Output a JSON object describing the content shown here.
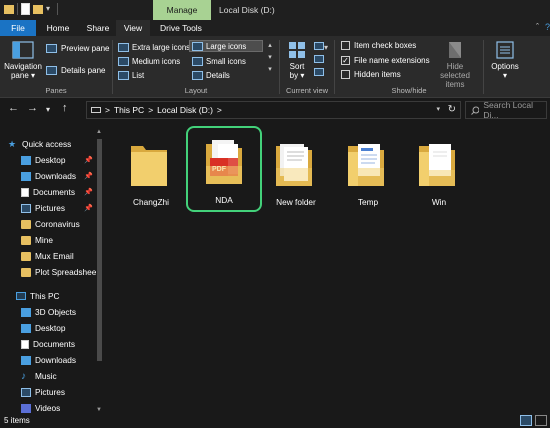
{
  "window": {
    "title": "Local Disk (D:)",
    "manage_label": "Manage"
  },
  "tabs": [
    {
      "label": "File"
    },
    {
      "label": "Home"
    },
    {
      "label": "Share"
    },
    {
      "label": "View"
    },
    {
      "label": "Drive Tools"
    }
  ],
  "ribbon": {
    "panes": {
      "group_label": "Panes",
      "navigation_pane": "Navigation pane",
      "navigation_line1": "Navigation",
      "navigation_line2": "pane ▾",
      "preview_pane": "Preview pane",
      "details_pane": "Details pane"
    },
    "layout": {
      "group_label": "Layout",
      "items": [
        {
          "label": "Extra large icons",
          "selected": false
        },
        {
          "label": "Large icons",
          "selected": true
        },
        {
          "label": "Medium icons",
          "selected": false
        },
        {
          "label": "Small icons",
          "selected": false
        },
        {
          "label": "List",
          "selected": false
        },
        {
          "label": "Details",
          "selected": false
        }
      ]
    },
    "current_view": {
      "group_label": "Current view",
      "sort_line1": "Sort",
      "sort_line2": "by ▾"
    },
    "show_hide": {
      "group_label": "Show/hide",
      "item_check_boxes": {
        "label": "Item check boxes",
        "checked": false
      },
      "file_name_extensions": {
        "label": "File name extensions",
        "checked": true
      },
      "hidden_items": {
        "label": "Hidden items",
        "checked": false
      },
      "hide_selected_line1": "Hide selected",
      "hide_selected_line2": "items"
    },
    "options": {
      "label": "Options",
      "caret": "▾"
    }
  },
  "address_bar": {
    "crumbs": [
      "This PC",
      "Local Disk (D:)"
    ],
    "separator": ">"
  },
  "search": {
    "placeholder": "Search Local Di..."
  },
  "nav_pane": {
    "quick_access": "Quick access",
    "items": [
      {
        "label": "Desktop",
        "icon": "desktop-icon",
        "pinned": true
      },
      {
        "label": "Downloads",
        "icon": "downloads-icon",
        "pinned": true
      },
      {
        "label": "Documents",
        "icon": "documents-icon",
        "pinned": true
      },
      {
        "label": "Pictures",
        "icon": "pictures-icon",
        "pinned": true
      },
      {
        "label": "Coronavirus",
        "icon": "folder-icon",
        "pinned": false
      },
      {
        "label": "Mine",
        "icon": "folder-icon",
        "pinned": false
      },
      {
        "label": "Mux Email",
        "icon": "folder-icon",
        "pinned": false
      },
      {
        "label": "Plot Spreadshee",
        "icon": "folder-icon",
        "pinned": false
      }
    ],
    "this_pc": "This PC",
    "pc_items": [
      {
        "label": "3D Objects",
        "icon": "3d-objects-icon"
      },
      {
        "label": "Desktop",
        "icon": "desktop-icon"
      },
      {
        "label": "Documents",
        "icon": "documents-icon"
      },
      {
        "label": "Downloads",
        "icon": "downloads-icon"
      },
      {
        "label": "Music",
        "icon": "music-icon"
      },
      {
        "label": "Pictures",
        "icon": "pictures-icon"
      },
      {
        "label": "Videos",
        "icon": "videos-icon"
      }
    ]
  },
  "files": [
    {
      "name": "ChangZhi",
      "type": "folder-empty",
      "selected": false
    },
    {
      "name": "NDA",
      "type": "folder-pdf",
      "selected": true
    },
    {
      "name": "New folder",
      "type": "folder-docs",
      "selected": false
    },
    {
      "name": "Temp",
      "type": "folder-blue-doc",
      "selected": false
    },
    {
      "name": "Win",
      "type": "folder-doc",
      "selected": false
    }
  ],
  "status": {
    "count_text": "5 items"
  },
  "colors": {
    "accent": "#1a73c4",
    "manage_tab": "#a8d293",
    "selection_outline": "#43d17a",
    "folder": "#e7c061",
    "background": "#191919"
  }
}
